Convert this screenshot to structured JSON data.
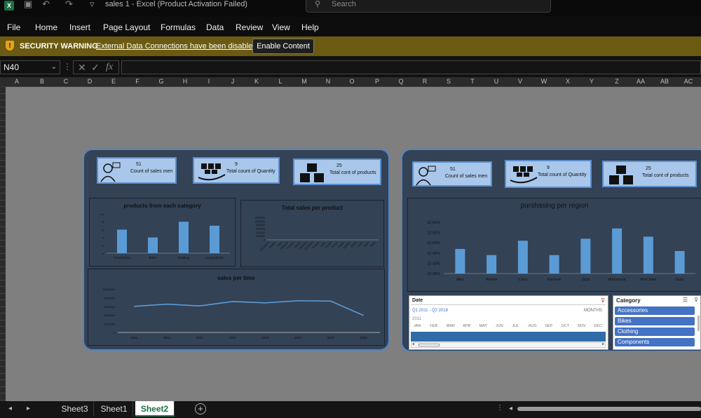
{
  "titlebar": {
    "app_icon": "X",
    "title": "sales 1  -  Excel (Product Activation Failed)",
    "search_placeholder": "Search"
  },
  "menu": [
    "File",
    "Home",
    "Insert",
    "Page Layout",
    "Formulas",
    "Data",
    "Review",
    "View",
    "Help"
  ],
  "security": {
    "label": "SECURITY WARNING",
    "message": "External Data Connections have been disabled",
    "button": "Enable Content"
  },
  "formula": {
    "namebox": "N40",
    "fx": "fx",
    "value": ""
  },
  "columns": [
    "A",
    "B",
    "C",
    "D",
    "E",
    "F",
    "G",
    "H",
    "I",
    "J",
    "K",
    "L",
    "M",
    "N",
    "O",
    "P",
    "Q",
    "R",
    "S",
    "T",
    "U",
    "V",
    "W",
    "X",
    "Y",
    "Z",
    "AA",
    "AB",
    "AC"
  ],
  "dash1": {
    "kpis": [
      {
        "value": "51",
        "label": "Count of sales men",
        "icon": "salesman-icon"
      },
      {
        "value": "9",
        "label": "Total count of Quantity",
        "icon": "hand-boxes-icon"
      },
      {
        "value": "25",
        "label": "Total cont of products",
        "icon": "boxes-icon"
      }
    ],
    "cat_chart": {
      "title": "products from each category",
      "categories": [
        "Accessories",
        "Bikes",
        "Clothing",
        "Components"
      ],
      "values": [
        6,
        4,
        8,
        7
      ],
      "yticks": [
        "10",
        "8",
        "6",
        "4",
        "2",
        "0"
      ]
    },
    "prod_chart": {
      "title": "Total sales per product",
      "yticks": [
        "12000000",
        "10000000",
        "8000000",
        "6000000",
        "4000000",
        "2000000",
        "0"
      ],
      "labels": [
        "Bib-Shorts",
        "Bottles",
        "Caps",
        "Cleaners",
        "Fenders",
        "Gloves",
        "Helmets",
        "Hydration",
        "Jerseys",
        "Locks",
        "Pedals",
        "Pumps",
        "Racks",
        "Saddles",
        "Shorts",
        "Socks",
        "Tights",
        "Vests"
      ]
    },
    "time_chart": {
      "title": "sales per time",
      "years": [
        "2011",
        "2012",
        "2013",
        "2014",
        "2015",
        "2016",
        "2017",
        "2018"
      ],
      "values": [
        6000000,
        6500000,
        6100000,
        7100000,
        6800000,
        7300000,
        7200000,
        3900000
      ],
      "yticks": [
        "10000000",
        "8000000",
        "6000000",
        "4000000",
        "2000000",
        "0"
      ]
    }
  },
  "dash2": {
    "kpis": [
      {
        "value": "51",
        "label": "Count of sales men",
        "icon": "salesman-icon"
      },
      {
        "value": "9",
        "label": "Total count of Quantity",
        "icon": "hand-boxes-icon"
      },
      {
        "value": "25",
        "label": "Total cont of products",
        "icon": "boxes-icon"
      }
    ],
    "region_chart": {
      "title": "purshasing per region",
      "categories": [
        "Alex",
        "Aswan",
        "Cairo",
        "Fayoum",
        "Giza",
        "Mansoura",
        "Port Said",
        "Suez"
      ],
      "values": [
        12.47,
        12.44,
        12.51,
        12.44,
        12.52,
        12.57,
        12.53,
        12.46
      ],
      "yticks": [
        "12.60%",
        "12.55%",
        "12.50%",
        "12.45%",
        "12.40%",
        "12.35%"
      ]
    },
    "date_slicer": {
      "title": "Date",
      "range": "Q1 2011 - Q2 2018",
      "mode": "MONTHS",
      "year": "2011",
      "months": [
        "JAN",
        "FEB",
        "MAR",
        "APR",
        "MAY",
        "JUN",
        "JUL",
        "AUG",
        "SEP",
        "OCT",
        "NOV",
        "DEC"
      ]
    },
    "cat_slicer": {
      "title": "Category",
      "items": [
        "Accessories",
        "Bikes",
        "Clothing",
        "Components"
      ]
    }
  },
  "sheets": [
    "Sheet3",
    "Sheet1",
    "Sheet2"
  ],
  "active_sheet": "Sheet2"
}
